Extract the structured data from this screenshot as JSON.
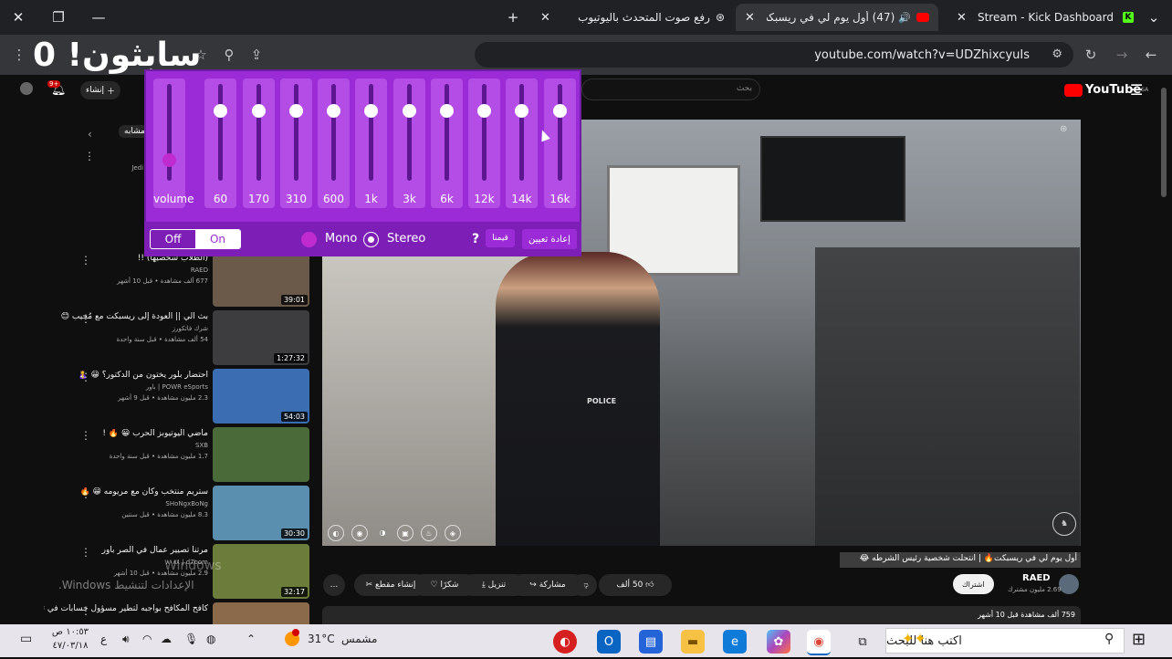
{
  "tabs": [
    {
      "title": "Stream - Kick Dashboard",
      "active": false
    },
    {
      "title": "(47) أول يوم لي في ريسبكت",
      "active": true
    },
    {
      "title": "رفع صوت المتحدث باليوتيوب",
      "active": false
    }
  ],
  "toolbar": {
    "url": "youtube.com/watch?v=UDZhixcyuIs",
    "overlay_text": "سابثون! 0"
  },
  "youtube": {
    "logo": "YouTube",
    "logo_sup": "SA",
    "search_placeholder": "بحث",
    "create_label": "إنشاء",
    "notif_count": "9+",
    "sidebar_chip": "مشابه",
    "sidebar_top_meta": "تم النشر من صنفان 24 Jedi",
    "windows_watermark_1": "Windows",
    "windows_watermark_2": "الإعدادات لتنشيط Windows.",
    "videos": [
      {
        "title": "(الطلاب شخصيها) !!",
        "channel": "RAED",
        "meta": "677 ألف مشاهدة • قبل 10 أشهر",
        "duration": "39:01",
        "color": "#6b5a4a"
      },
      {
        "title": "بث الي || العودة إلى ريسبكت مع مُجيب 😊",
        "channel": "شرك فاتكورز",
        "meta": "54 ألف مشاهدة • قبل سنة واحدة",
        "duration": "1:27:32",
        "color": "#3d3d3f"
      },
      {
        "title": "احتضار بلور يختون من الدكتور؟ 😀 🤱",
        "channel": "POWR eSports | باور",
        "meta": "2.3 مليون مشاهدة • قبل 9 أشهر",
        "duration": "54:03",
        "color": "#3a6db2"
      },
      {
        "title": "ماضي اليوتيوبز الحرب 😀 🔥 !",
        "channel": "SXB",
        "meta": "1.7 مليون مشاهدة • قبل سنة واحدة",
        "duration": "",
        "color": "#4a6a3a"
      },
      {
        "title": "ستريم منتخب وكان مع مريومه 😀 🔥",
        "channel": "SHoNgxBoNg",
        "meta": "8.3 مليون مشاهدة • قبل سنتين",
        "duration": "30:30",
        "color": "#5a8fb0"
      },
      {
        "title": "مرتنا تصيير عمال في الصر باور",
        "channel": "d7oom | ٨٠٨٨",
        "meta": "2.9 مليون مشاهدة • قبل 10 أشهر",
        "duration": "32:17",
        "color": "#6c7c3a"
      },
      {
        "title": "كافح المكافح بواجبه لتطير مسؤول حسابات في تاريخ مدينة ريسبكت",
        "channel": "",
        "meta": "",
        "duration": "",
        "color": "#8a6a4a"
      }
    ],
    "video_title": "أول يوم لي في ريسبكت🔥 | انتحلت شخصية رئيس الشرطه 😂",
    "channel_name": "RAED",
    "subs": "2.69 مليون مشترك",
    "subscribe": "اشتراك",
    "likes": "50 ألف",
    "share": "مشاركة",
    "download": "تنزيل",
    "thanks": "شكرًا",
    "clip": "إنشاء مقطع",
    "more": "...",
    "views_date": "759 ألف مشاهدة قبل 10 أشهر"
  },
  "equalizer": {
    "bands": [
      {
        "label": "volume",
        "level": 0.22
      },
      {
        "label": "60",
        "level": 0.73
      },
      {
        "label": "170",
        "level": 0.73
      },
      {
        "label": "310",
        "level": 0.73
      },
      {
        "label": "600",
        "level": 0.73
      },
      {
        "label": "1k",
        "level": 0.73
      },
      {
        "label": "3k",
        "level": 0.73
      },
      {
        "label": "6k",
        "level": 0.73
      },
      {
        "label": "12k",
        "level": 0.73
      },
      {
        "label": "14k",
        "level": 0.73
      },
      {
        "label": "16k",
        "level": 0.73
      }
    ],
    "off_label": "Off",
    "on_label": "On",
    "mono_label": "Mono",
    "stereo_label": "Stereo",
    "help_label": "?",
    "presets_label": "قيمنا",
    "reset_label": "إعادة تعيين"
  },
  "taskbar": {
    "search_placeholder": "اكتب هنا للبحث",
    "weather_temp": "31°C",
    "weather_desc": "مشمس",
    "time": "١٠:٥٣ ص",
    "date": "٤٧/٠٣/١٨",
    "lang": "ع"
  },
  "colors": {
    "eq_bg": "#9b2bd6",
    "eq_band": "#b44de6",
    "mono_dot": "#c02bd0",
    "yt_red": "#ff0000"
  }
}
